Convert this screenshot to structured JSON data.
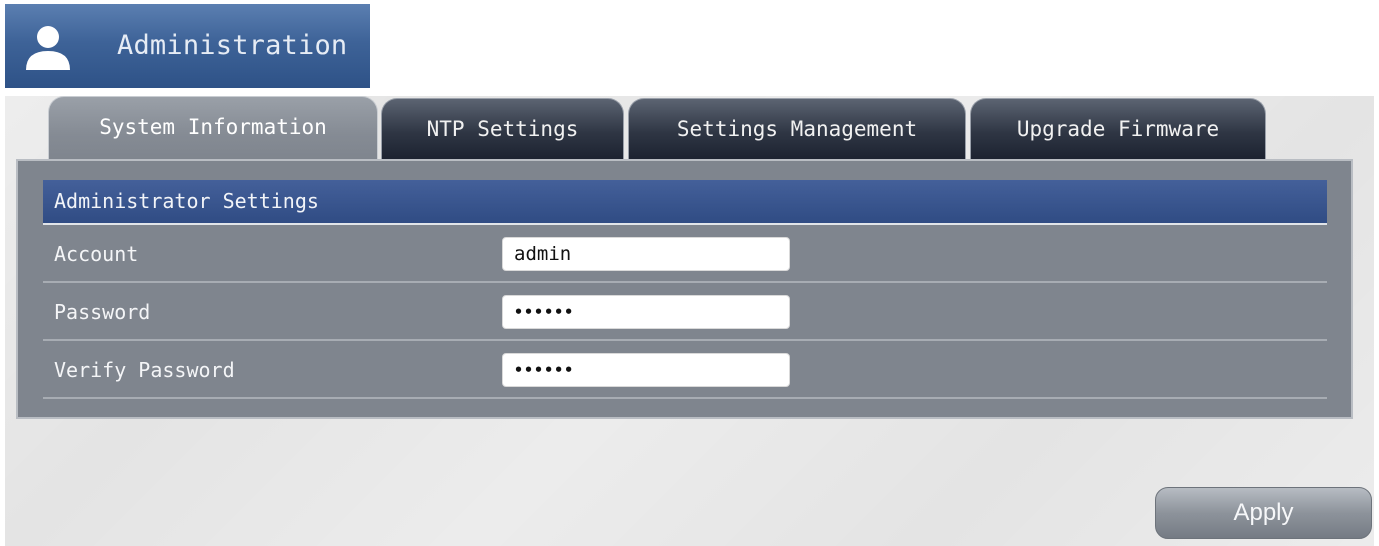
{
  "header": {
    "title": "Administration",
    "icon": "user-icon"
  },
  "tabs": [
    {
      "label": "System Information",
      "active": true
    },
    {
      "label": "NTP Settings",
      "active": false
    },
    {
      "label": "Settings Management",
      "active": false
    },
    {
      "label": "Upgrade Firmware",
      "active": false
    }
  ],
  "section": {
    "title": "Administrator Settings"
  },
  "fields": {
    "account": {
      "label": "Account",
      "value": "admin"
    },
    "password": {
      "label": "Password",
      "value": "••••••"
    },
    "verify_password": {
      "label": "Verify Password",
      "value": "••••••"
    }
  },
  "actions": {
    "apply_label": "Apply"
  },
  "colors": {
    "header_blue": "#3e6398",
    "section_blue": "#3a5690",
    "panel_gray": "#7f858e",
    "tab_dark": "#2f3644"
  }
}
